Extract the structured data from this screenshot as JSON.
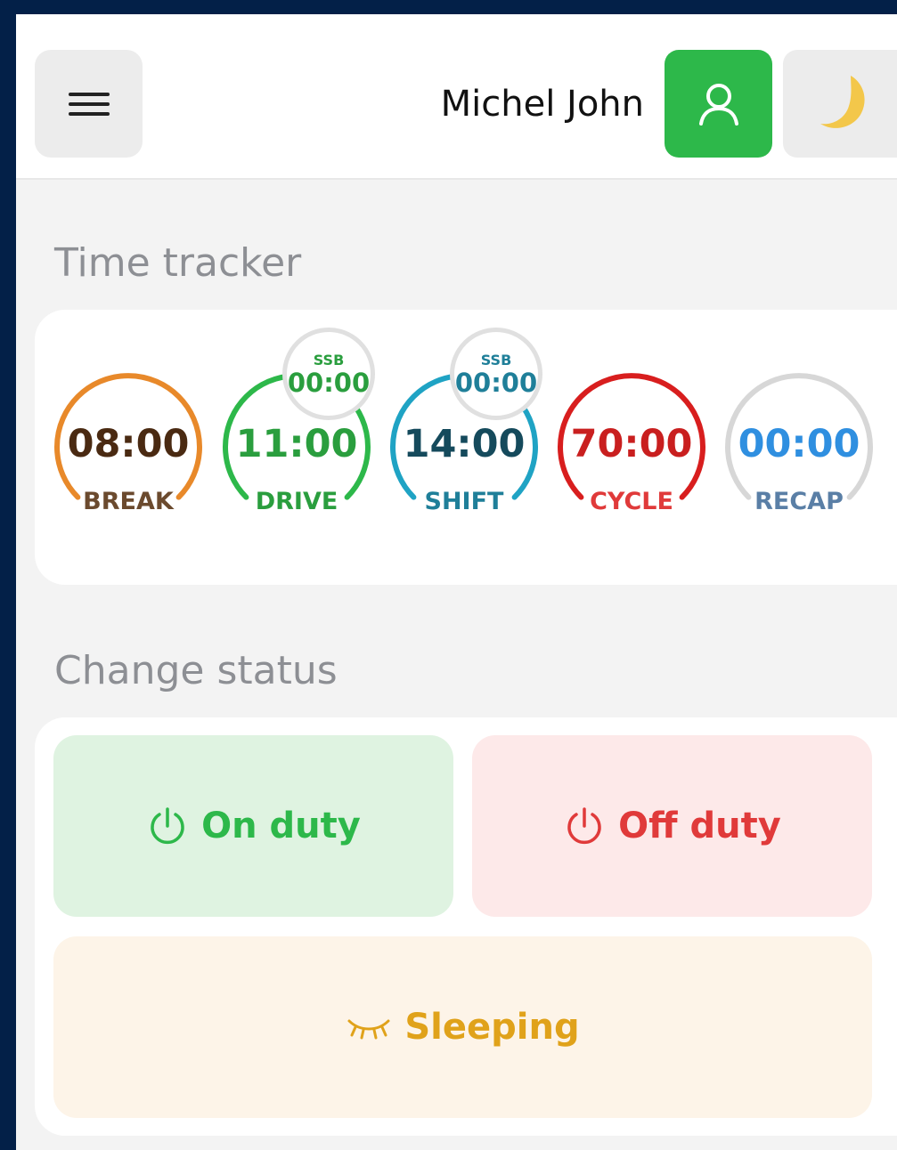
{
  "header": {
    "user_name": "Michel John",
    "menu_icon": "hamburger-menu-icon",
    "profile_icon": "user-icon",
    "theme_icon": "moon-icon",
    "profile_color": "#2db84a"
  },
  "time_tracker": {
    "title": "Time tracker",
    "gauges": [
      {
        "label": "BREAK",
        "value": "08:00",
        "color": "#e8892a",
        "value_color": "#4a2a12",
        "label_color": "#6b4a2e"
      },
      {
        "label": "DRIVE",
        "value": "11:00",
        "color": "#2db84a",
        "value_color": "#2a9e3e",
        "label_color": "#2a9e3e",
        "ssb_label": "SSB",
        "ssb_value": "00:00"
      },
      {
        "label": "SHIFT",
        "value": "14:00",
        "color": "#1fa3c4",
        "value_color": "#154a5c",
        "label_color": "#1f7f99",
        "ssb_label": "SSB",
        "ssb_value": "00:00"
      },
      {
        "label": "CYCLE",
        "value": "70:00",
        "color": "#d81e1e",
        "value_color": "#c91f1f",
        "label_color": "#e03a3a"
      },
      {
        "label": "RECAP",
        "value": "00:00",
        "color": "#d7d7d7",
        "value_color": "#2f8fe0",
        "label_color": "#5a7fa6"
      }
    ]
  },
  "change_status": {
    "title": "Change status",
    "on_duty": {
      "label": "On duty",
      "icon": "power-icon",
      "color": "#2db84a",
      "bg": "#dff3e1"
    },
    "off_duty": {
      "label": "Off duty",
      "icon": "power-icon",
      "color": "#e03a3a",
      "bg": "#fde9e9"
    },
    "sleeping": {
      "label": "Sleeping",
      "icon": "closed-eye-icon",
      "color": "#e0a21a",
      "bg": "#fdf4e8"
    }
  }
}
